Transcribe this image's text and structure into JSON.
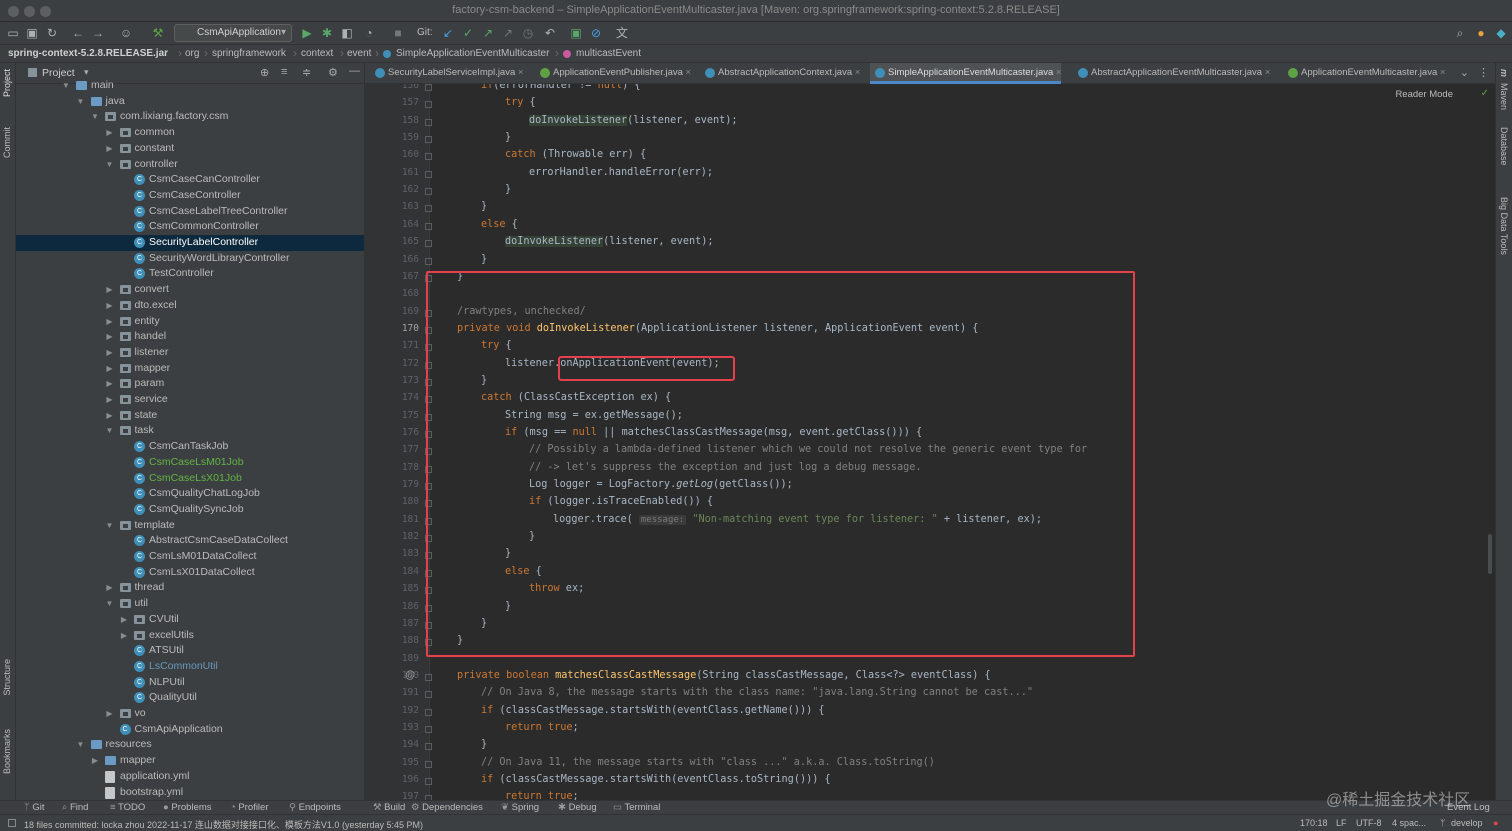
{
  "window": {
    "title": "factory-csm-backend – SimpleApplicationEventMulticaster.java [Maven: org.springframework:spring-context:5.2.8.RELEASE]"
  },
  "toolbar": {
    "run_config": "CsmApiApplication",
    "git_label": "Git:"
  },
  "breadcrumbs": [
    "spring-context-5.2.8.RELEASE.jar",
    "org",
    "springframework",
    "context",
    "event",
    "SimpleApplicationEventMulticaster",
    "multicastEvent"
  ],
  "left_strip": [
    "Project",
    "Commit",
    "Structure",
    "Bookmarks"
  ],
  "right_strip": [
    "m",
    "Maven",
    "Database",
    "Big Data Tools"
  ],
  "project": {
    "header": "Project",
    "tree": [
      {
        "label": "main",
        "indent": 5,
        "kind": "folder",
        "arrow": "open"
      },
      {
        "label": "java",
        "indent": 6,
        "kind": "folder",
        "arrow": "open"
      },
      {
        "label": "com.lixiang.factory.csm",
        "indent": 7,
        "kind": "pkg",
        "arrow": "open"
      },
      {
        "label": "common",
        "indent": 8,
        "kind": "pkg",
        "arrow": "closed"
      },
      {
        "label": "constant",
        "indent": 8,
        "kind": "pkg",
        "arrow": "closed"
      },
      {
        "label": "controller",
        "indent": 8,
        "kind": "pkg",
        "arrow": "open"
      },
      {
        "label": "CsmCaseCanController",
        "indent": 9,
        "kind": "class"
      },
      {
        "label": "CsmCaseController",
        "indent": 9,
        "kind": "class"
      },
      {
        "label": "CsmCaseLabelTreeController",
        "indent": 9,
        "kind": "class"
      },
      {
        "label": "CsmCommonController",
        "indent": 9,
        "kind": "class"
      },
      {
        "label": "SecurityLabelController",
        "indent": 9,
        "kind": "class",
        "selected": true
      },
      {
        "label": "SecurityWordLibraryController",
        "indent": 9,
        "kind": "class"
      },
      {
        "label": "TestController",
        "indent": 9,
        "kind": "class"
      },
      {
        "label": "convert",
        "indent": 8,
        "kind": "pkg",
        "arrow": "closed"
      },
      {
        "label": "dto.excel",
        "indent": 8,
        "kind": "pkg",
        "arrow": "closed"
      },
      {
        "label": "entity",
        "indent": 8,
        "kind": "pkg",
        "arrow": "closed"
      },
      {
        "label": "handel",
        "indent": 8,
        "kind": "pkg",
        "arrow": "closed"
      },
      {
        "label": "listener",
        "indent": 8,
        "kind": "pkg",
        "arrow": "closed"
      },
      {
        "label": "mapper",
        "indent": 8,
        "kind": "pkg",
        "arrow": "closed"
      },
      {
        "label": "param",
        "indent": 8,
        "kind": "pkg",
        "arrow": "closed"
      },
      {
        "label": "service",
        "indent": 8,
        "kind": "pkg",
        "arrow": "closed"
      },
      {
        "label": "state",
        "indent": 8,
        "kind": "pkg",
        "arrow": "closed"
      },
      {
        "label": "task",
        "indent": 8,
        "kind": "pkg",
        "arrow": "open"
      },
      {
        "label": "CsmCanTaskJob",
        "indent": 9,
        "kind": "class"
      },
      {
        "label": "CsmCaseLsM01Job",
        "indent": 9,
        "kind": "class",
        "vcs": "added"
      },
      {
        "label": "CsmCaseLsX01Job",
        "indent": 9,
        "kind": "class",
        "vcs": "added"
      },
      {
        "label": "CsmQualityChatLogJob",
        "indent": 9,
        "kind": "class"
      },
      {
        "label": "CsmQualitySyncJob",
        "indent": 9,
        "kind": "class"
      },
      {
        "label": "template",
        "indent": 8,
        "kind": "pkg",
        "arrow": "open"
      },
      {
        "label": "AbstractCsmCaseDataCollect",
        "indent": 9,
        "kind": "class"
      },
      {
        "label": "CsmLsM01DataCollect",
        "indent": 9,
        "kind": "class"
      },
      {
        "label": "CsmLsX01DataCollect",
        "indent": 9,
        "kind": "class"
      },
      {
        "label": "thread",
        "indent": 8,
        "kind": "pkg",
        "arrow": "closed"
      },
      {
        "label": "util",
        "indent": 8,
        "kind": "pkg",
        "arrow": "open"
      },
      {
        "label": "CVUtil",
        "indent": 9,
        "kind": "pkg",
        "arrow": "closed"
      },
      {
        "label": "excelUtils",
        "indent": 9,
        "kind": "pkg",
        "arrow": "closed"
      },
      {
        "label": "ATSUtil",
        "indent": 9,
        "kind": "class"
      },
      {
        "label": "LsCommonUtil",
        "indent": 9,
        "kind": "class",
        "vcs": "modified"
      },
      {
        "label": "NLPUtil",
        "indent": 9,
        "kind": "class"
      },
      {
        "label": "QualityUtil",
        "indent": 9,
        "kind": "class"
      },
      {
        "label": "vo",
        "indent": 8,
        "kind": "pkg",
        "arrow": "closed"
      },
      {
        "label": "CsmApiApplication",
        "indent": 8,
        "kind": "class"
      },
      {
        "label": "resources",
        "indent": 6,
        "kind": "folder",
        "arrow": "open"
      },
      {
        "label": "mapper",
        "indent": 7,
        "kind": "folder",
        "arrow": "closed"
      },
      {
        "label": "application.yml",
        "indent": 7,
        "kind": "file"
      },
      {
        "label": "bootstrap.yml",
        "indent": 7,
        "kind": "file"
      }
    ]
  },
  "tabs": [
    {
      "label": "SecurityLabelServiceImpl.java"
    },
    {
      "label": "ApplicationEventPublisher.java"
    },
    {
      "label": "AbstractApplicationContext.java"
    },
    {
      "label": "SimpleApplicationEventMulticaster.java",
      "active": true
    },
    {
      "label": "AbstractApplicationEventMulticaster.java"
    },
    {
      "label": "ApplicationEventMulticaster.java"
    }
  ],
  "editor": {
    "reader_mode": "Reader Mode",
    "current_line": 170,
    "lines": [
      {
        "n": 156,
        "ind": 2,
        "t": [
          [
            "kw",
            "if"
          ],
          [
            "",
            "(errorHandler != "
          ],
          [
            "kw",
            "null"
          ],
          [
            "",
            ") {"
          ]
        ]
      },
      {
        "n": 157,
        "ind": 3,
        "t": [
          [
            "kw",
            "try"
          ],
          [
            "",
            " {"
          ]
        ]
      },
      {
        "n": 158,
        "ind": 4,
        "t": [
          [
            "hl",
            "doInvokeListener"
          ],
          [
            "",
            "(listener, event);"
          ]
        ]
      },
      {
        "n": 159,
        "ind": 3,
        "t": [
          [
            "",
            "}"
          ]
        ]
      },
      {
        "n": 160,
        "ind": 3,
        "t": [
          [
            "kw",
            "catch"
          ],
          [
            "",
            " (Throwable err) {"
          ]
        ]
      },
      {
        "n": 161,
        "ind": 4,
        "t": [
          [
            "",
            "errorHandler.handleError(err);"
          ]
        ]
      },
      {
        "n": 162,
        "ind": 3,
        "t": [
          [
            "",
            "}"
          ]
        ]
      },
      {
        "n": 163,
        "ind": 2,
        "t": [
          [
            "",
            "}"
          ]
        ]
      },
      {
        "n": 164,
        "ind": 2,
        "t": [
          [
            "kw",
            "else"
          ],
          [
            "",
            " {"
          ]
        ]
      },
      {
        "n": 165,
        "ind": 3,
        "t": [
          [
            "hl",
            "doInvokeListener"
          ],
          [
            "",
            "(listener, event);"
          ]
        ]
      },
      {
        "n": 166,
        "ind": 2,
        "t": [
          [
            "",
            "}"
          ]
        ]
      },
      {
        "n": 167,
        "ind": 1,
        "t": [
          [
            "",
            "}"
          ]
        ]
      },
      {
        "n": 168,
        "ind": 0,
        "t": []
      },
      {
        "n": 169,
        "ind": 1,
        "t": [
          [
            "cm",
            "/rawtypes, unchecked/"
          ]
        ]
      },
      {
        "n": 170,
        "ind": 1,
        "t": [
          [
            "kw",
            "private void "
          ],
          [
            "fn",
            "doInvokeListener"
          ],
          [
            "",
            "(ApplicationListener listener, ApplicationEvent event) {"
          ]
        ]
      },
      {
        "n": 171,
        "ind": 2,
        "t": [
          [
            "kw",
            "try"
          ],
          [
            "",
            " {"
          ]
        ]
      },
      {
        "n": 172,
        "ind": 3,
        "t": [
          [
            "",
            "listener."
          ],
          [
            "",
            "onApplicationEvent(event);"
          ]
        ]
      },
      {
        "n": 173,
        "ind": 2,
        "t": [
          [
            "",
            "}"
          ]
        ]
      },
      {
        "n": 174,
        "ind": 2,
        "t": [
          [
            "kw",
            "catch"
          ],
          [
            "",
            " (ClassCastException ex) {"
          ]
        ]
      },
      {
        "n": 175,
        "ind": 3,
        "t": [
          [
            "",
            "String msg = ex.getMessage();"
          ]
        ]
      },
      {
        "n": 176,
        "ind": 3,
        "t": [
          [
            "kw",
            "if"
          ],
          [
            "",
            " (msg == "
          ],
          [
            "kw",
            "null"
          ],
          [
            "",
            " || matchesClassCastMessage(msg, event.getClass())) {"
          ]
        ]
      },
      {
        "n": 177,
        "ind": 4,
        "t": [
          [
            "cm",
            "// Possibly a lambda-defined listener which we could not resolve the generic event type for"
          ]
        ]
      },
      {
        "n": 178,
        "ind": 4,
        "t": [
          [
            "cm",
            "// -> let's suppress the exception and just log a debug message."
          ]
        ]
      },
      {
        "n": 179,
        "ind": 4,
        "t": [
          [
            "",
            "Log logger = LogFactory."
          ],
          [
            "it",
            "getLog"
          ],
          [
            "",
            "(getClass());"
          ]
        ]
      },
      {
        "n": 180,
        "ind": 4,
        "t": [
          [
            "kw",
            "if"
          ],
          [
            "",
            " (logger.isTraceEnabled()) {"
          ]
        ]
      },
      {
        "n": 181,
        "ind": 5,
        "t": [
          [
            "",
            "logger.trace( "
          ],
          [
            "hint",
            "message:"
          ],
          [
            "st",
            " \"Non-matching event type for listener: \""
          ],
          [
            "",
            " + listener, ex);"
          ]
        ]
      },
      {
        "n": 182,
        "ind": 4,
        "t": [
          [
            "",
            "}"
          ]
        ]
      },
      {
        "n": 183,
        "ind": 3,
        "t": [
          [
            "",
            "}"
          ]
        ]
      },
      {
        "n": 184,
        "ind": 3,
        "t": [
          [
            "kw",
            "else"
          ],
          [
            "",
            " {"
          ]
        ]
      },
      {
        "n": 185,
        "ind": 4,
        "t": [
          [
            "kw",
            "throw"
          ],
          [
            "",
            " ex;"
          ]
        ]
      },
      {
        "n": 186,
        "ind": 3,
        "t": [
          [
            "",
            "}"
          ]
        ]
      },
      {
        "n": 187,
        "ind": 2,
        "t": [
          [
            "",
            "}"
          ]
        ]
      },
      {
        "n": 188,
        "ind": 1,
        "t": [
          [
            "",
            "}"
          ]
        ]
      },
      {
        "n": 189,
        "ind": 0,
        "t": []
      },
      {
        "n": 190,
        "ind": 1,
        "t": [
          [
            "kw",
            "private boolean "
          ],
          [
            "fn",
            "matchesClassCastMessage"
          ],
          [
            "",
            "(String classCastMessage, Class<?> eventClass) {"
          ]
        ]
      },
      {
        "n": 191,
        "ind": 2,
        "t": [
          [
            "cm",
            "// On Java 8, the message starts with the class name: \"java.lang.String cannot be cast...\""
          ]
        ]
      },
      {
        "n": 192,
        "ind": 2,
        "t": [
          [
            "kw",
            "if"
          ],
          [
            "",
            " (classCastMessage.startsWith(eventClass.getName())) {"
          ]
        ]
      },
      {
        "n": 193,
        "ind": 3,
        "t": [
          [
            "kw",
            "return true"
          ],
          [
            "",
            ";"
          ]
        ]
      },
      {
        "n": 194,
        "ind": 2,
        "t": [
          [
            "",
            "}"
          ]
        ]
      },
      {
        "n": 195,
        "ind": 2,
        "t": [
          [
            "cm",
            "// On Java 11, the message starts with \"class ...\" a.k.a. Class.toString()"
          ]
        ]
      },
      {
        "n": 196,
        "ind": 2,
        "t": [
          [
            "kw",
            "if"
          ],
          [
            "",
            " (classCastMessage.startsWith(eventClass.toString())) {"
          ]
        ]
      },
      {
        "n": 197,
        "ind": 3,
        "t": [
          [
            "kw",
            "return true"
          ],
          [
            "",
            ";"
          ]
        ]
      }
    ]
  },
  "bottom_tools": [
    "Git",
    "Find",
    "TODO",
    "Problems",
    "Profiler",
    "Endpoints",
    "Build",
    "Dependencies",
    "Spring",
    "Debug",
    "Terminal"
  ],
  "event_log": "Event Log",
  "status": {
    "message": "18 files committed: locka zhou 2022-11-17 连山数据对接接口化、模板方法V1.0 (yesterday 5:45 PM)",
    "position": "170:18",
    "line_sep": "LF",
    "encoding": "UTF-8",
    "indent": "4 spac...",
    "branch": "develop"
  },
  "watermark": "@稀土掘金技术社区"
}
